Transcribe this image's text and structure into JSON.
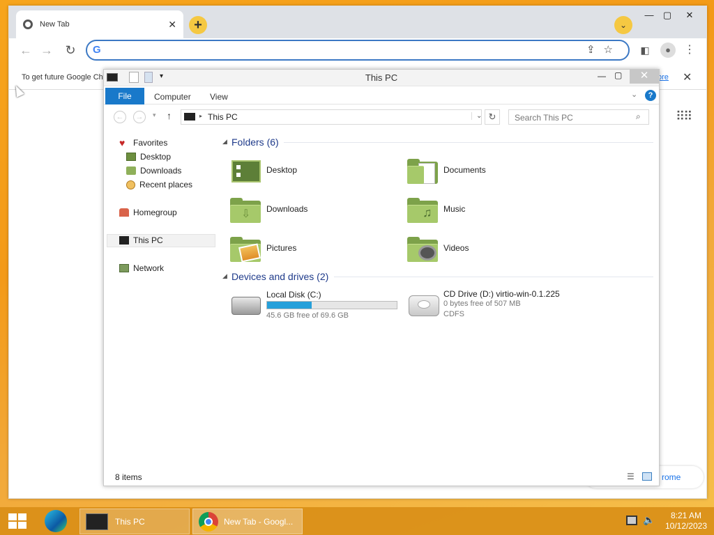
{
  "chrome": {
    "tab_title": "New Tab",
    "new_tab_glyph": "+",
    "infobar_text": "To get future Google Chi",
    "infobar_link_fragment": "ore",
    "bottom_link_fragment": "rome",
    "omnibox_placeholder": ""
  },
  "explorer": {
    "title": "This PC",
    "ribbon_tabs": [
      "File",
      "Computer",
      "View"
    ],
    "address_path": "This PC",
    "search_placeholder": "Search This PC",
    "nav": {
      "favorites": "Favorites",
      "desktop": "Desktop",
      "downloads": "Downloads",
      "recent": "Recent places",
      "homegroup": "Homegroup",
      "thispc": "This PC",
      "network": "Network"
    },
    "folders_header": "Folders (6)",
    "folders": [
      "Desktop",
      "Documents",
      "Downloads",
      "Music",
      "Pictures",
      "Videos"
    ],
    "devices_header": "Devices and drives (2)",
    "drives": [
      {
        "name": "Local Disk (C:)",
        "detail": "45.6 GB free of 69.6 GB",
        "used_fraction": 0.345
      },
      {
        "name": "CD Drive (D:) virtio-win-0.1.225",
        "detail": "0 bytes free of 507 MB",
        "fs": "CDFS"
      }
    ],
    "status": "8 items"
  },
  "taskbar": {
    "explorer_label": "This PC",
    "chrome_label": "New Tab - Googl...",
    "time": "8:21 AM",
    "date": "10/12/2023"
  },
  "colors": {
    "accent": "#1979ca",
    "folder_green": "#a6c96a",
    "taskbar": "#d78c14"
  }
}
